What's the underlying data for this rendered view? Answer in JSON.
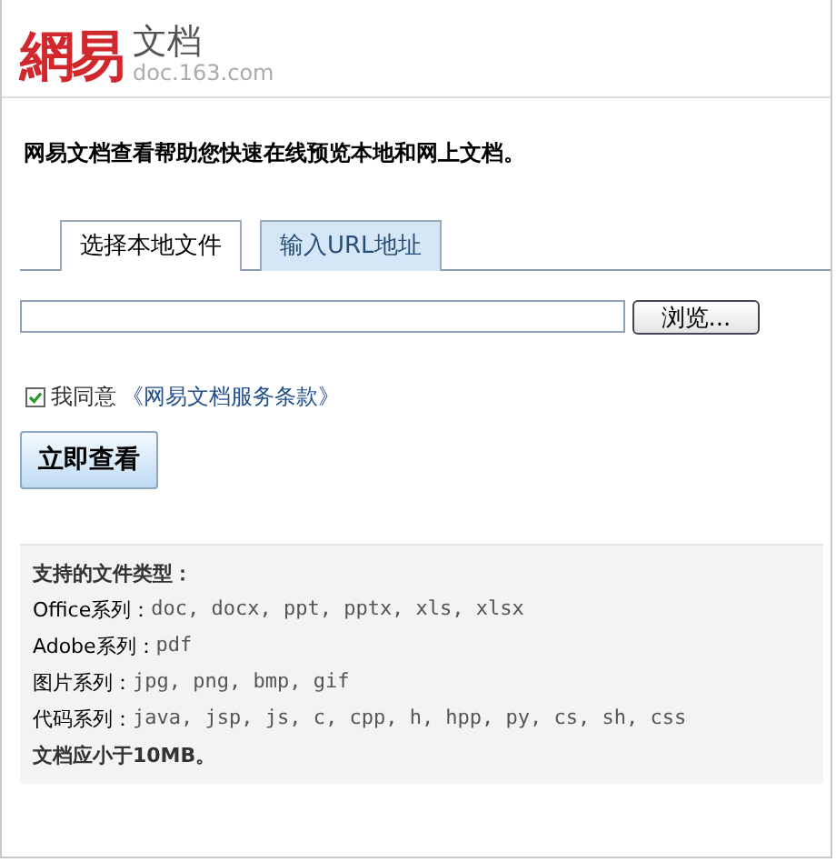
{
  "logo": {
    "mark": "網易",
    "name": "文档",
    "domain": "doc.163.com"
  },
  "intro": "网易文档查看帮助您快速在线预览本地和网上文档。",
  "tabs": [
    {
      "label": "选择本地文件",
      "selected": true
    },
    {
      "label": "输入URL地址",
      "selected": false
    }
  ],
  "browse_button": "浏览...",
  "agreement": {
    "checked": true,
    "prefix": "我同意",
    "link": "《网易文档服务条款》"
  },
  "submit_button": "立即查看",
  "info": {
    "title": "支持的文件类型：",
    "rows": [
      {
        "label": "Office系列：",
        "value": "doc, docx, ppt, pptx, xls, xlsx"
      },
      {
        "label": "Adobe系列：",
        "value": "pdf"
      },
      {
        "label": "图片系列：",
        "value": "jpg, png, bmp, gif"
      },
      {
        "label": "代码系列：",
        "value": "java, jsp, js, c, cpp, h, hpp, py, cs, sh, css"
      }
    ],
    "note": "文档应小于10MB。"
  }
}
